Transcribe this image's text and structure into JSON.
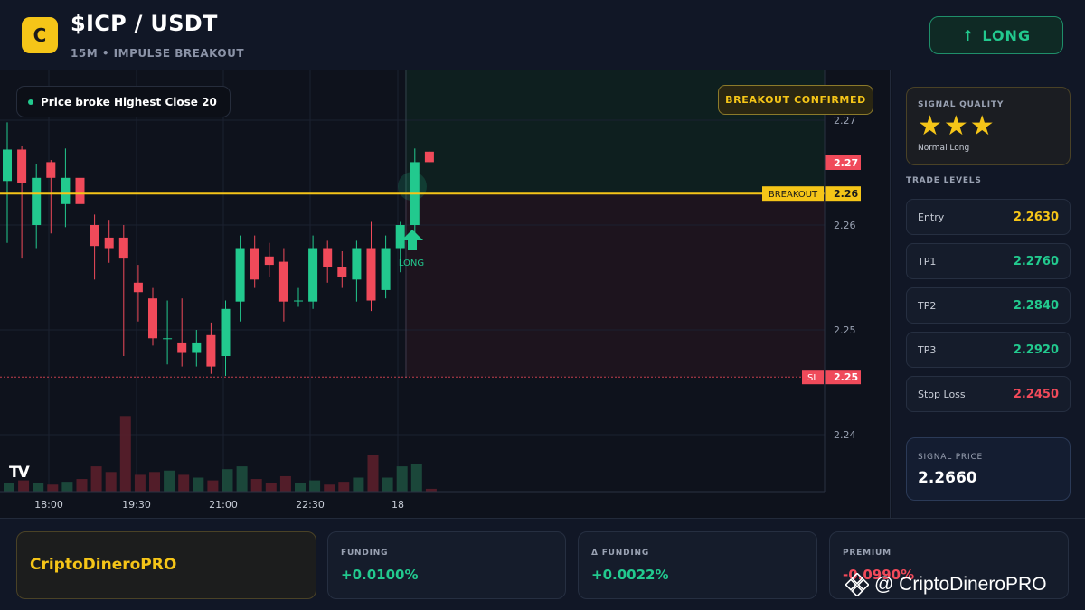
{
  "header": {
    "logo_letter": "C",
    "pair": "$ICP / USDT",
    "subtitle": "15M • IMPULSE BREAKOUT",
    "direction_button": {
      "arrow": "↑",
      "label": "LONG"
    }
  },
  "chart": {
    "note": "Price broke Highest Close 20",
    "badge": "BREAKOUT CONFIRMED",
    "tv_logo": "TV",
    "long_marker_label": "LONG",
    "breakout_label": "BREAKOUT",
    "sl_label": "SL",
    "price_labels": [
      "2.27",
      "2.26",
      "2.25"
    ]
  },
  "chart_data": {
    "type": "candlestick",
    "x_ticks": [
      "18:00",
      "19:30",
      "21:00",
      "22:30",
      "18"
    ],
    "y_ticks": [
      2.27,
      2.26,
      2.25,
      2.24
    ],
    "breakout_level": 2.263,
    "stop_loss_level": 2.2455,
    "last_price_tag": 2.27,
    "colors": {
      "up": "#22c98e",
      "down": "#f04a5a",
      "breakout": "#f5c518"
    },
    "candles": [
      {
        "o": 2.2642,
        "h": 2.2698,
        "l": 2.2583,
        "c": 2.2672
      },
      {
        "o": 2.2672,
        "h": 2.2675,
        "l": 2.2568,
        "c": 2.264
      },
      {
        "o": 2.26,
        "h": 2.2658,
        "l": 2.2578,
        "c": 2.2645
      },
      {
        "o": 2.266,
        "h": 2.2662,
        "l": 2.2592,
        "c": 2.2645
      },
      {
        "o": 2.262,
        "h": 2.2673,
        "l": 2.2598,
        "c": 2.2645
      },
      {
        "o": 2.2645,
        "h": 2.2658,
        "l": 2.2588,
        "c": 2.262
      },
      {
        "o": 2.26,
        "h": 2.261,
        "l": 2.2548,
        "c": 2.258
      },
      {
        "o": 2.2588,
        "h": 2.2605,
        "l": 2.2564,
        "c": 2.2578
      },
      {
        "o": 2.2588,
        "h": 2.26,
        "l": 2.2475,
        "c": 2.2568
      },
      {
        "o": 2.2545,
        "h": 2.2562,
        "l": 2.2508,
        "c": 2.2536
      },
      {
        "o": 2.253,
        "h": 2.254,
        "l": 2.2485,
        "c": 2.2492
      },
      {
        "o": 2.2492,
        "h": 2.2528,
        "l": 2.2467,
        "c": 2.2492
      },
      {
        "o": 2.2488,
        "h": 2.253,
        "l": 2.2465,
        "c": 2.2478
      },
      {
        "o": 2.2478,
        "h": 2.25,
        "l": 2.2465,
        "c": 2.2488
      },
      {
        "o": 2.2495,
        "h": 2.2507,
        "l": 2.2458,
        "c": 2.2465
      },
      {
        "o": 2.2475,
        "h": 2.2528,
        "l": 2.2456,
        "c": 2.252
      },
      {
        "o": 2.2527,
        "h": 2.259,
        "l": 2.2508,
        "c": 2.2578
      },
      {
        "o": 2.2578,
        "h": 2.259,
        "l": 2.254,
        "c": 2.2548
      },
      {
        "o": 2.257,
        "h": 2.2583,
        "l": 2.255,
        "c": 2.2562
      },
      {
        "o": 2.2565,
        "h": 2.2578,
        "l": 2.2508,
        "c": 2.2527
      },
      {
        "o": 2.2528,
        "h": 2.254,
        "l": 2.2522,
        "c": 2.2528
      },
      {
        "o": 2.2527,
        "h": 2.259,
        "l": 2.252,
        "c": 2.2578
      },
      {
        "o": 2.2578,
        "h": 2.2585,
        "l": 2.2545,
        "c": 2.256
      },
      {
        "o": 2.256,
        "h": 2.2575,
        "l": 2.254,
        "c": 2.255
      },
      {
        "o": 2.2548,
        "h": 2.2585,
        "l": 2.2527,
        "c": 2.2578
      },
      {
        "o": 2.2578,
        "h": 2.2603,
        "l": 2.2518,
        "c": 2.2528
      },
      {
        "o": 2.2538,
        "h": 2.259,
        "l": 2.253,
        "c": 2.2578
      },
      {
        "o": 2.2578,
        "h": 2.2603,
        "l": 2.2555,
        "c": 2.26
      },
      {
        "o": 2.26,
        "h": 2.2673,
        "l": 2.2592,
        "c": 2.266
      },
      {
        "o": 2.267,
        "h": 2.267,
        "l": 2.266,
        "c": 2.266
      }
    ],
    "volume_bars": [
      {
        "v": 6,
        "up": true
      },
      {
        "v": 8,
        "up": false
      },
      {
        "v": 6,
        "up": true
      },
      {
        "v": 5,
        "up": false
      },
      {
        "v": 7,
        "up": true
      },
      {
        "v": 9,
        "up": false
      },
      {
        "v": 18,
        "up": false
      },
      {
        "v": 14,
        "up": false
      },
      {
        "v": 54,
        "up": false
      },
      {
        "v": 12,
        "up": false
      },
      {
        "v": 14,
        "up": false
      },
      {
        "v": 15,
        "up": true
      },
      {
        "v": 12,
        "up": false
      },
      {
        "v": 10,
        "up": true
      },
      {
        "v": 8,
        "up": false
      },
      {
        "v": 16,
        "up": true
      },
      {
        "v": 18,
        "up": true
      },
      {
        "v": 9,
        "up": false
      },
      {
        "v": 6,
        "up": false
      },
      {
        "v": 11,
        "up": false
      },
      {
        "v": 6,
        "up": true
      },
      {
        "v": 8,
        "up": true
      },
      {
        "v": 5,
        "up": false
      },
      {
        "v": 7,
        "up": false
      },
      {
        "v": 10,
        "up": true
      },
      {
        "v": 26,
        "up": false
      },
      {
        "v": 10,
        "up": true
      },
      {
        "v": 18,
        "up": true
      },
      {
        "v": 20,
        "up": true
      },
      {
        "v": 2,
        "up": false
      }
    ]
  },
  "side": {
    "quality": {
      "title": "SIGNAL QUALITY",
      "stars": "★★★",
      "rating": 3,
      "subtitle": "Normal Long"
    },
    "levels_title": "TRADE LEVELS",
    "levels": [
      {
        "label": "Entry",
        "value": "2.2630",
        "color": "#f5c518"
      },
      {
        "label": "TP1",
        "value": "2.2760",
        "color": "#22c98e"
      },
      {
        "label": "TP2",
        "value": "2.2840",
        "color": "#22c98e"
      },
      {
        "label": "TP3",
        "value": "2.2920",
        "color": "#22c98e"
      },
      {
        "label": "Stop Loss",
        "value": "2.2450",
        "color": "#f04a5a"
      }
    ],
    "signal_price": {
      "title": "SIGNAL PRICE",
      "value": "2.2660"
    }
  },
  "footer": {
    "brand": "CriptoDineroPRO",
    "stats": [
      {
        "title": "FUNDING",
        "value": "+0.0100%",
        "color": "#22c98e"
      },
      {
        "title": "Δ FUNDING",
        "value": "+0.0022%",
        "color": "#22c98e"
      },
      {
        "title": "PREMIUM",
        "value": "-0.0990%",
        "color": "#f04a5a"
      }
    ],
    "watermark": "@ CriptoDineroPRO"
  }
}
